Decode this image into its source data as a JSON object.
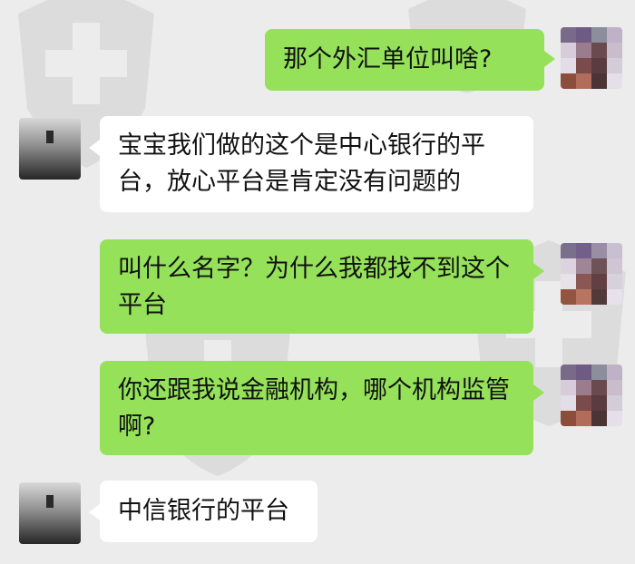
{
  "chat": {
    "messages": [
      {
        "side": "right",
        "text": "那个外汇单位叫啥?"
      },
      {
        "side": "left",
        "text": "宝宝我们做的这个是中心银行的平台，放心平台是肯定没有问题的"
      },
      {
        "side": "right",
        "text": "叫什么名字？为什么我都找不到这个平台"
      },
      {
        "side": "right",
        "text": "你还跟我说金融机构，哪个机构监管啊?"
      },
      {
        "side": "left",
        "text": "中信银行的平台"
      }
    ]
  },
  "colors": {
    "background": "#ececec",
    "bubble_sent": "#95e25a",
    "bubble_received": "#ffffff",
    "watermark": "#9a9a9a"
  },
  "icons": {
    "watermark": "shield-cross-icon",
    "sender_avatar": "pixelated-avatar",
    "receiver_avatar": "photo-avatar"
  }
}
